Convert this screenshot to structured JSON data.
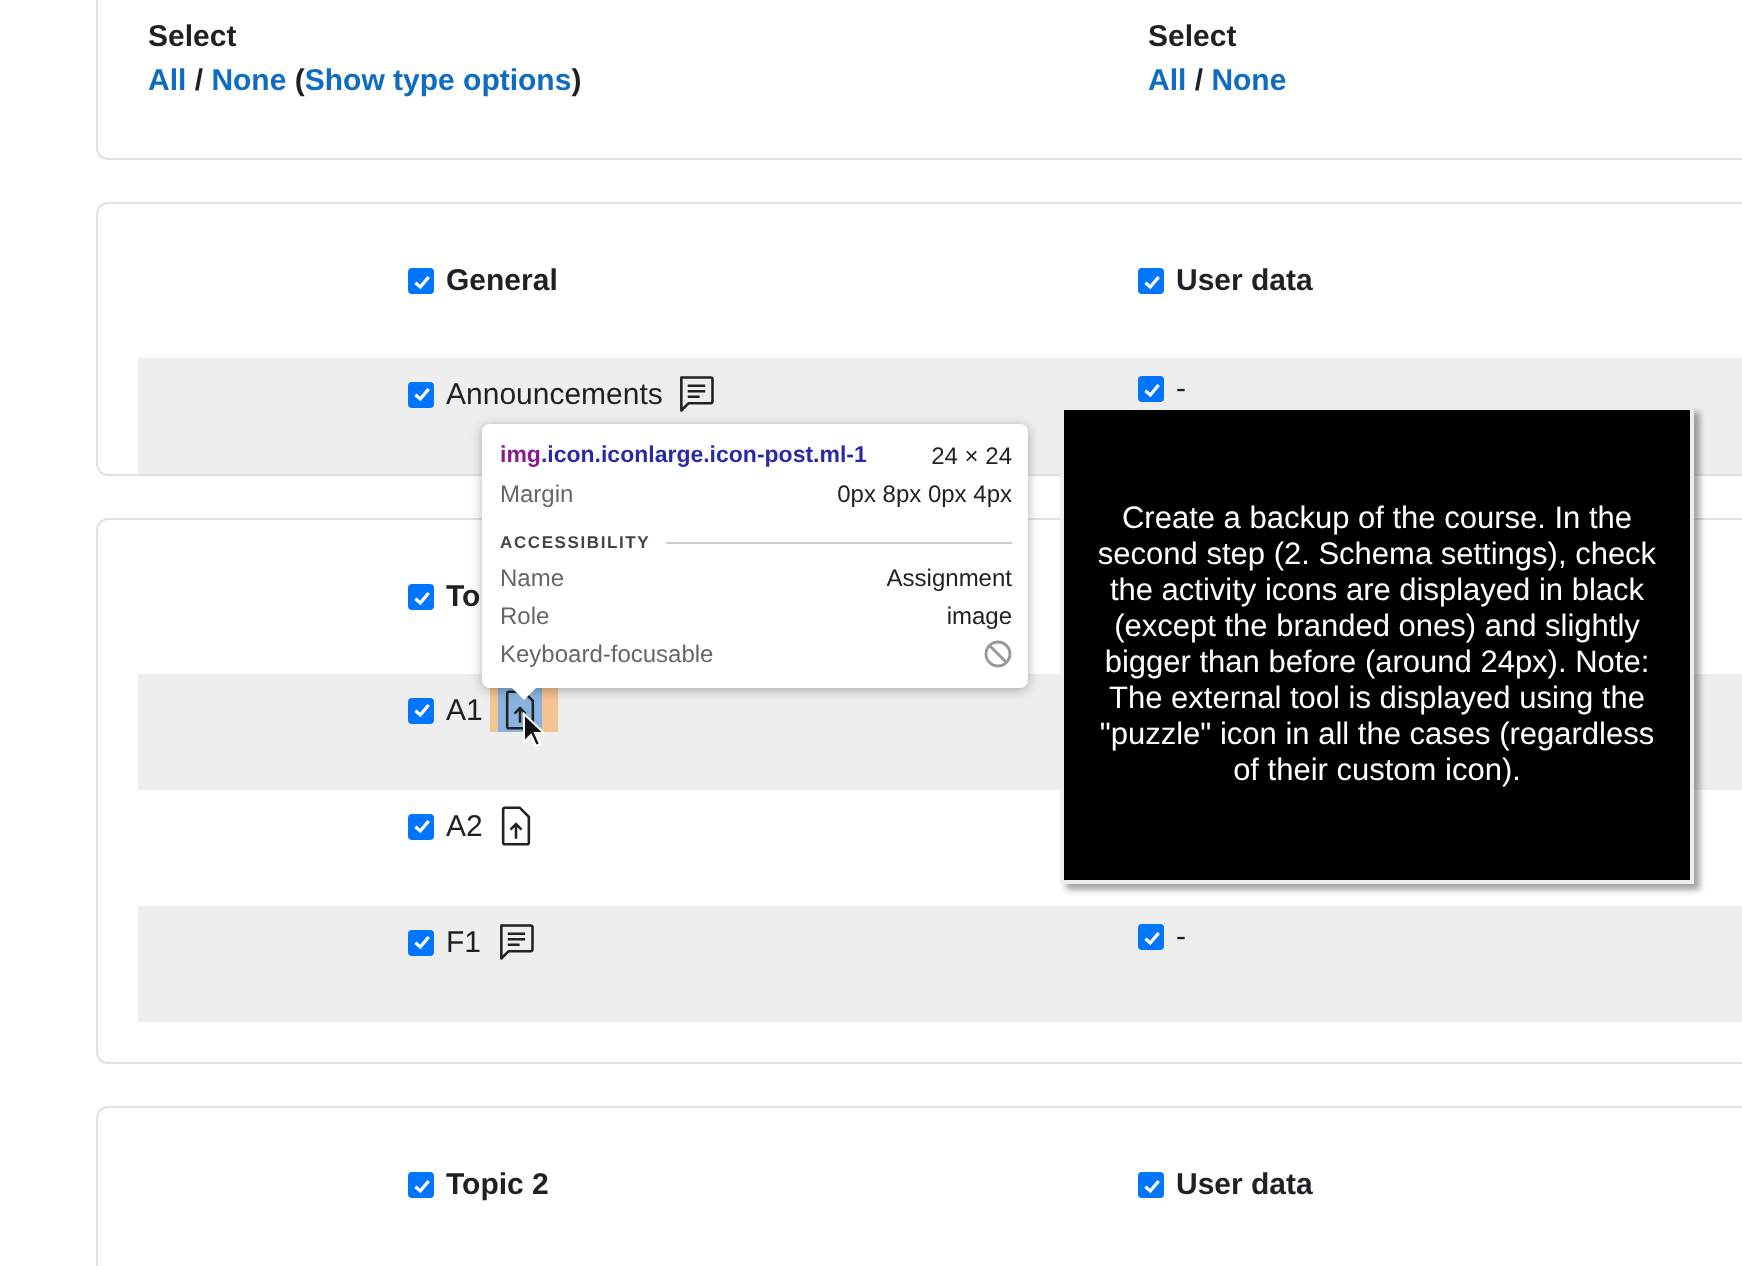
{
  "select_panel": {
    "columns": [
      {
        "label": "Select",
        "parts": [
          {
            "kind": "link",
            "text": "All"
          },
          {
            "kind": "text",
            "text": " / "
          },
          {
            "kind": "link",
            "text": "None"
          },
          {
            "kind": "text",
            "text": " ("
          },
          {
            "kind": "link",
            "text": "Show type options"
          },
          {
            "kind": "text",
            "text": ")"
          }
        ]
      },
      {
        "label": "Select",
        "parts": [
          {
            "kind": "link",
            "text": "All"
          },
          {
            "kind": "text",
            "text": " / "
          },
          {
            "kind": "link",
            "text": "None"
          }
        ]
      }
    ]
  },
  "sections": [
    {
      "title": "General",
      "checked": true,
      "user_data": {
        "label": "User data",
        "checked": true
      },
      "items": [
        {
          "name": "Announcements",
          "kind": "forum",
          "checked": true,
          "highlighted": false,
          "user_data": {
            "checked": true,
            "value": "-"
          }
        }
      ]
    },
    {
      "title": "To",
      "checked": true,
      "items": [
        {
          "name": "A1",
          "kind": "assignment",
          "checked": true,
          "highlighted": true
        },
        {
          "name": "A2",
          "kind": "assignment",
          "checked": true,
          "highlighted": false
        },
        {
          "name": "F1",
          "kind": "forum",
          "checked": true,
          "highlighted": false,
          "user_data": {
            "checked": true,
            "value": "-"
          }
        }
      ]
    },
    {
      "title": "Topic 2",
      "checked": true,
      "user_data": {
        "label": "User data",
        "checked": true
      }
    }
  ],
  "inspector": {
    "tag": "img",
    "classes": ".icon.iconlarge.icon-post.ml-1",
    "size": "24 × 24",
    "margin_label": "Margin",
    "margin_value": "0px 8px 0px 4px",
    "section": "ACCESSIBILITY",
    "props": [
      {
        "label": "Name",
        "kind": "text",
        "value": "Assignment"
      },
      {
        "label": "Role",
        "kind": "text",
        "value": "image"
      },
      {
        "label": "Keyboard-focusable",
        "kind": "flag",
        "focusable": false
      }
    ]
  },
  "note": {
    "text": "Create a backup of the course. In the second step (2. Schema settings), check the activity icons are displayed in black (except the branded ones) and slightly bigger than before (around 24px). Note: The external tool is displayed using the \"puzzle\" icon in all the cases (regardless of their custom icon)."
  }
}
